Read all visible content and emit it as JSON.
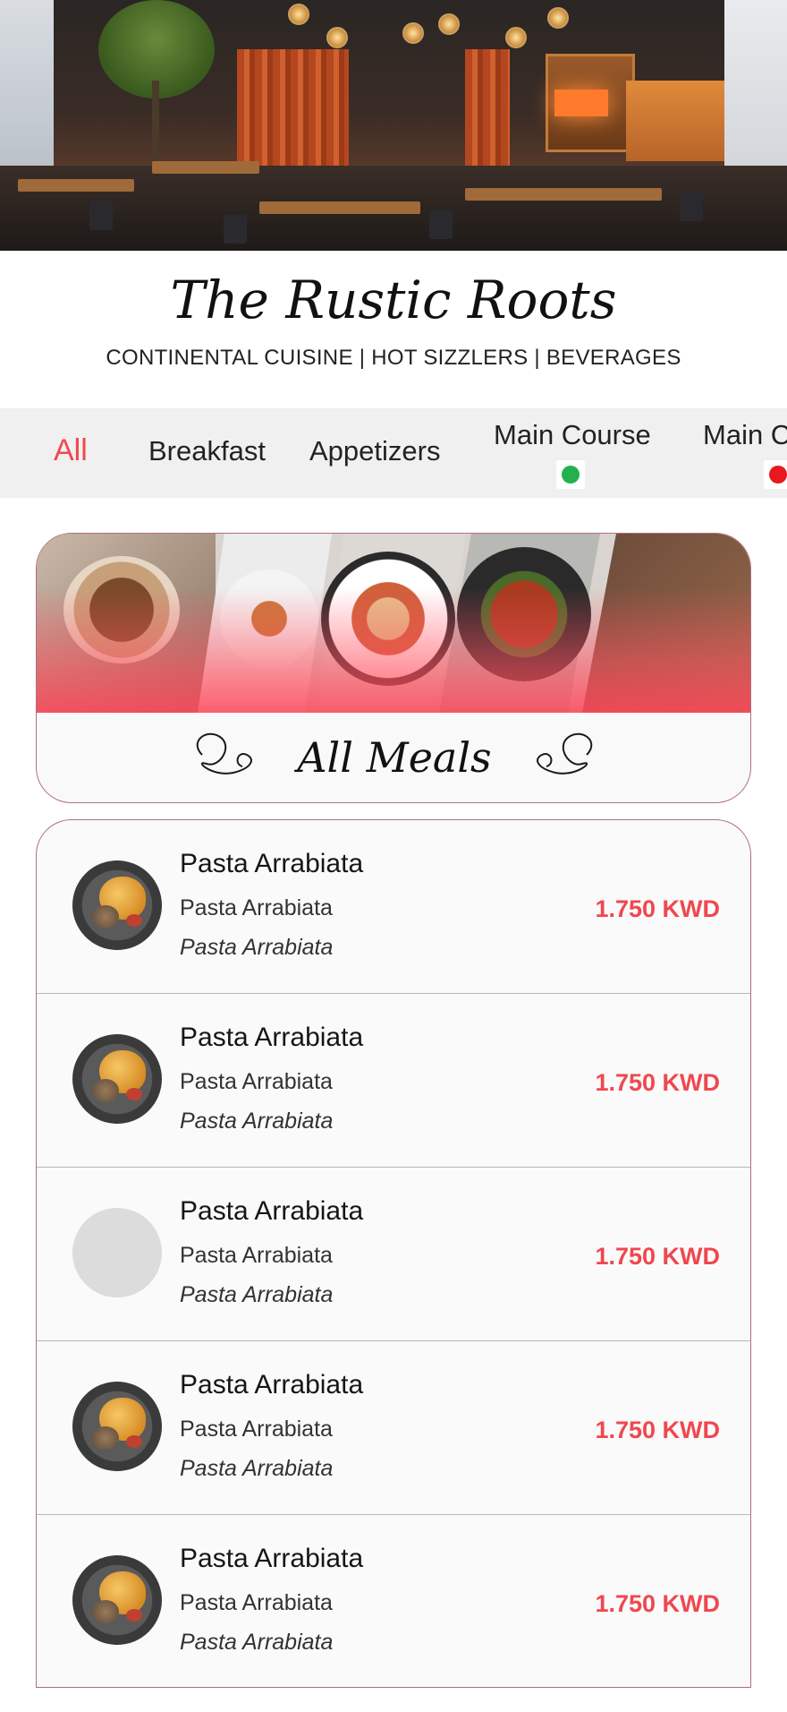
{
  "hero": {
    "image": "restaurant-interior"
  },
  "brand": {
    "name": "The Rustic Roots",
    "tagline": "CONTINENTAL CUISINE | HOT SIZZLERS | BEVERAGES"
  },
  "tabs": [
    {
      "label": "All",
      "active": true
    },
    {
      "label": "Breakfast",
      "active": false
    },
    {
      "label": "Appetizers",
      "active": false
    },
    {
      "label": "Main Course",
      "active": false,
      "indicator": "veg",
      "indicator_color": "#22b14c"
    },
    {
      "label": "Main C",
      "active": false,
      "indicator": "non-veg",
      "indicator_color": "#e8181f"
    }
  ],
  "banner": {
    "title": "All Meals",
    "image": "food-collage"
  },
  "menu_items": [
    {
      "name": "Pasta Arrabiata",
      "subtitle": "Pasta Arrabiata",
      "description": "Pasta Arrabiata",
      "price": "1.750 KWD",
      "has_image": true
    },
    {
      "name": "Pasta Arrabiata",
      "subtitle": "Pasta Arrabiata",
      "description": "Pasta Arrabiata",
      "price": "1.750 KWD",
      "has_image": true
    },
    {
      "name": "Pasta Arrabiata",
      "subtitle": "Pasta Arrabiata",
      "description": "Pasta Arrabiata",
      "price": "1.750 KWD",
      "has_image": false
    },
    {
      "name": "Pasta Arrabiata",
      "subtitle": "Pasta Arrabiata",
      "description": "Pasta Arrabiata",
      "price": "1.750 KWD",
      "has_image": true
    },
    {
      "name": "Pasta Arrabiata",
      "subtitle": "Pasta Arrabiata",
      "description": "Pasta Arrabiata",
      "price": "1.750 KWD",
      "has_image": true
    }
  ],
  "colors": {
    "accent": "#f0474f",
    "tab_bar_bg": "#f0f0f0",
    "card_border": "#b07080"
  }
}
